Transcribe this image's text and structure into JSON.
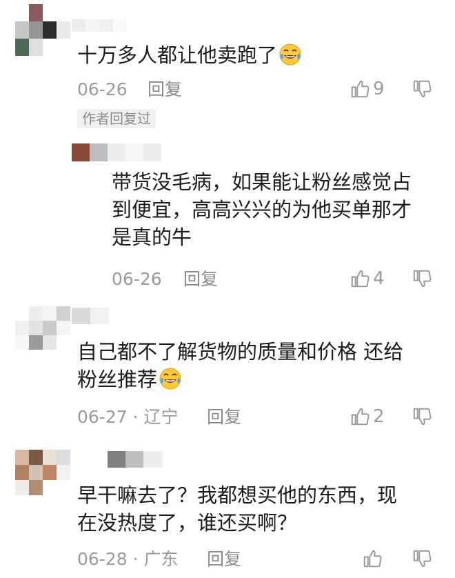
{
  "comments": [
    {
      "text": "十万多人都让他卖跑了",
      "date": "06-26",
      "reply": "回复",
      "likes": "9",
      "author_tag": "作者回复过"
    },
    {
      "text_lines": [
        "带货没毛病，如果能让粉丝感觉占",
        "到便宜，高高兴兴的为他买单那才",
        "是真的牛"
      ],
      "date": "06-26",
      "reply": "回复",
      "likes": "4"
    },
    {
      "text_lines": [
        "自己都不了解货物的质量和价格  还给",
        "粉丝推荐"
      ],
      "date": "06-27 · 辽宁",
      "reply": "回复",
      "likes": "2"
    },
    {
      "text_lines": [
        "早干嘛去了？我都想买他的东西，现",
        "在没热度了，谁还买啊？"
      ],
      "date": "06-28 · 广东",
      "reply": "回复"
    }
  ],
  "colors": {
    "meta": "#9a9a9a",
    "text": "#1c1c1c",
    "tag_bg": "#f0f0f0"
  },
  "icons": [
    "thumbs-up-icon",
    "thumbs-down-icon",
    "laughing-crying-emoji"
  ]
}
